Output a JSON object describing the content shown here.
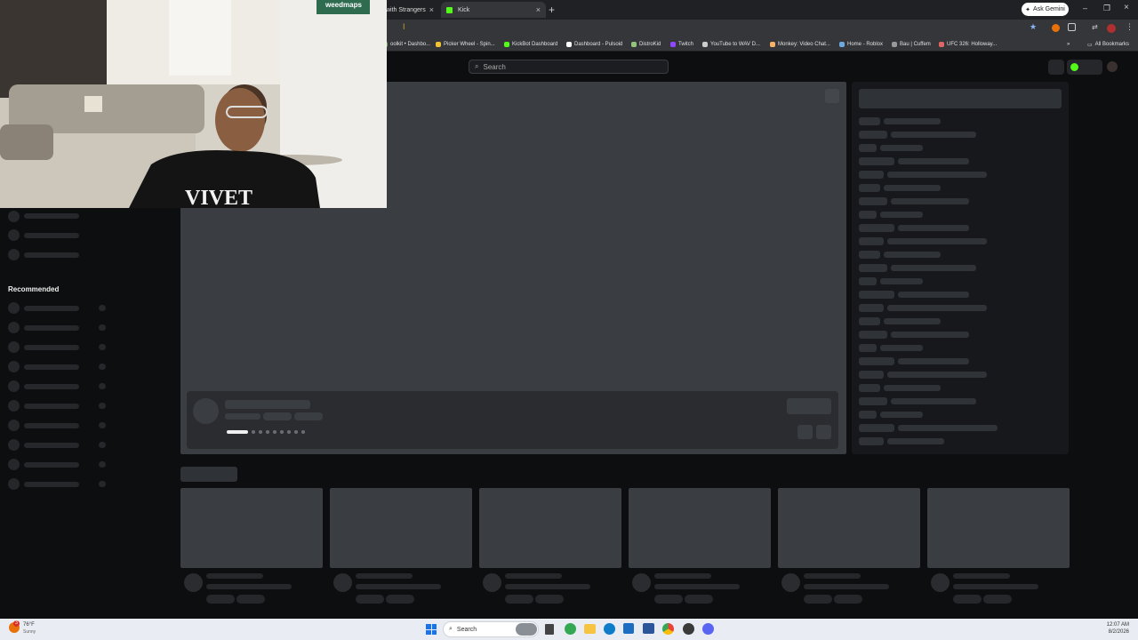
{
  "browser": {
    "tabs": [
      {
        "label": "with Strangers",
        "active": false
      },
      {
        "label": "Kick",
        "active": true
      }
    ],
    "ask_gemini": "Ask Gemini",
    "bookmarks": [
      {
        "label": "oolkit • Dashbo...",
        "color": "#6aa84f"
      },
      {
        "label": "Picker Wheel - Spin...",
        "color": "#f1c232"
      },
      {
        "label": "KickBot Dashboard",
        "color": "#53fc18"
      },
      {
        "label": "Dashboard - Pulsoid",
        "color": "#ffffff"
      },
      {
        "label": "DistroKid",
        "color": "#93c47d"
      },
      {
        "label": "Twitch",
        "color": "#9146ff"
      },
      {
        "label": "YouTube to WAV D...",
        "color": "#cccccc"
      },
      {
        "label": "Monkey: Video Chat...",
        "color": "#f6b26b"
      },
      {
        "label": "Home - Roblox",
        "color": "#6fa8dc"
      },
      {
        "label": "Bau | Cuffem",
        "color": "#999999"
      },
      {
        "label": "UFC 326: Holloway...",
        "color": "#e06666"
      }
    ],
    "all_bookmarks": "All Bookmarks"
  },
  "site": {
    "search_placeholder": "Search",
    "recommended_label": "Recommended",
    "accent": "#53fc18"
  },
  "webcam": {
    "banner": "weedmaps",
    "shirt_text": "VIVET"
  },
  "taskbar": {
    "weather_temp": "76°F",
    "weather_desc": "Sunny",
    "search_label": "Search",
    "time": "12:07 AM",
    "date": "8/2/2026"
  }
}
